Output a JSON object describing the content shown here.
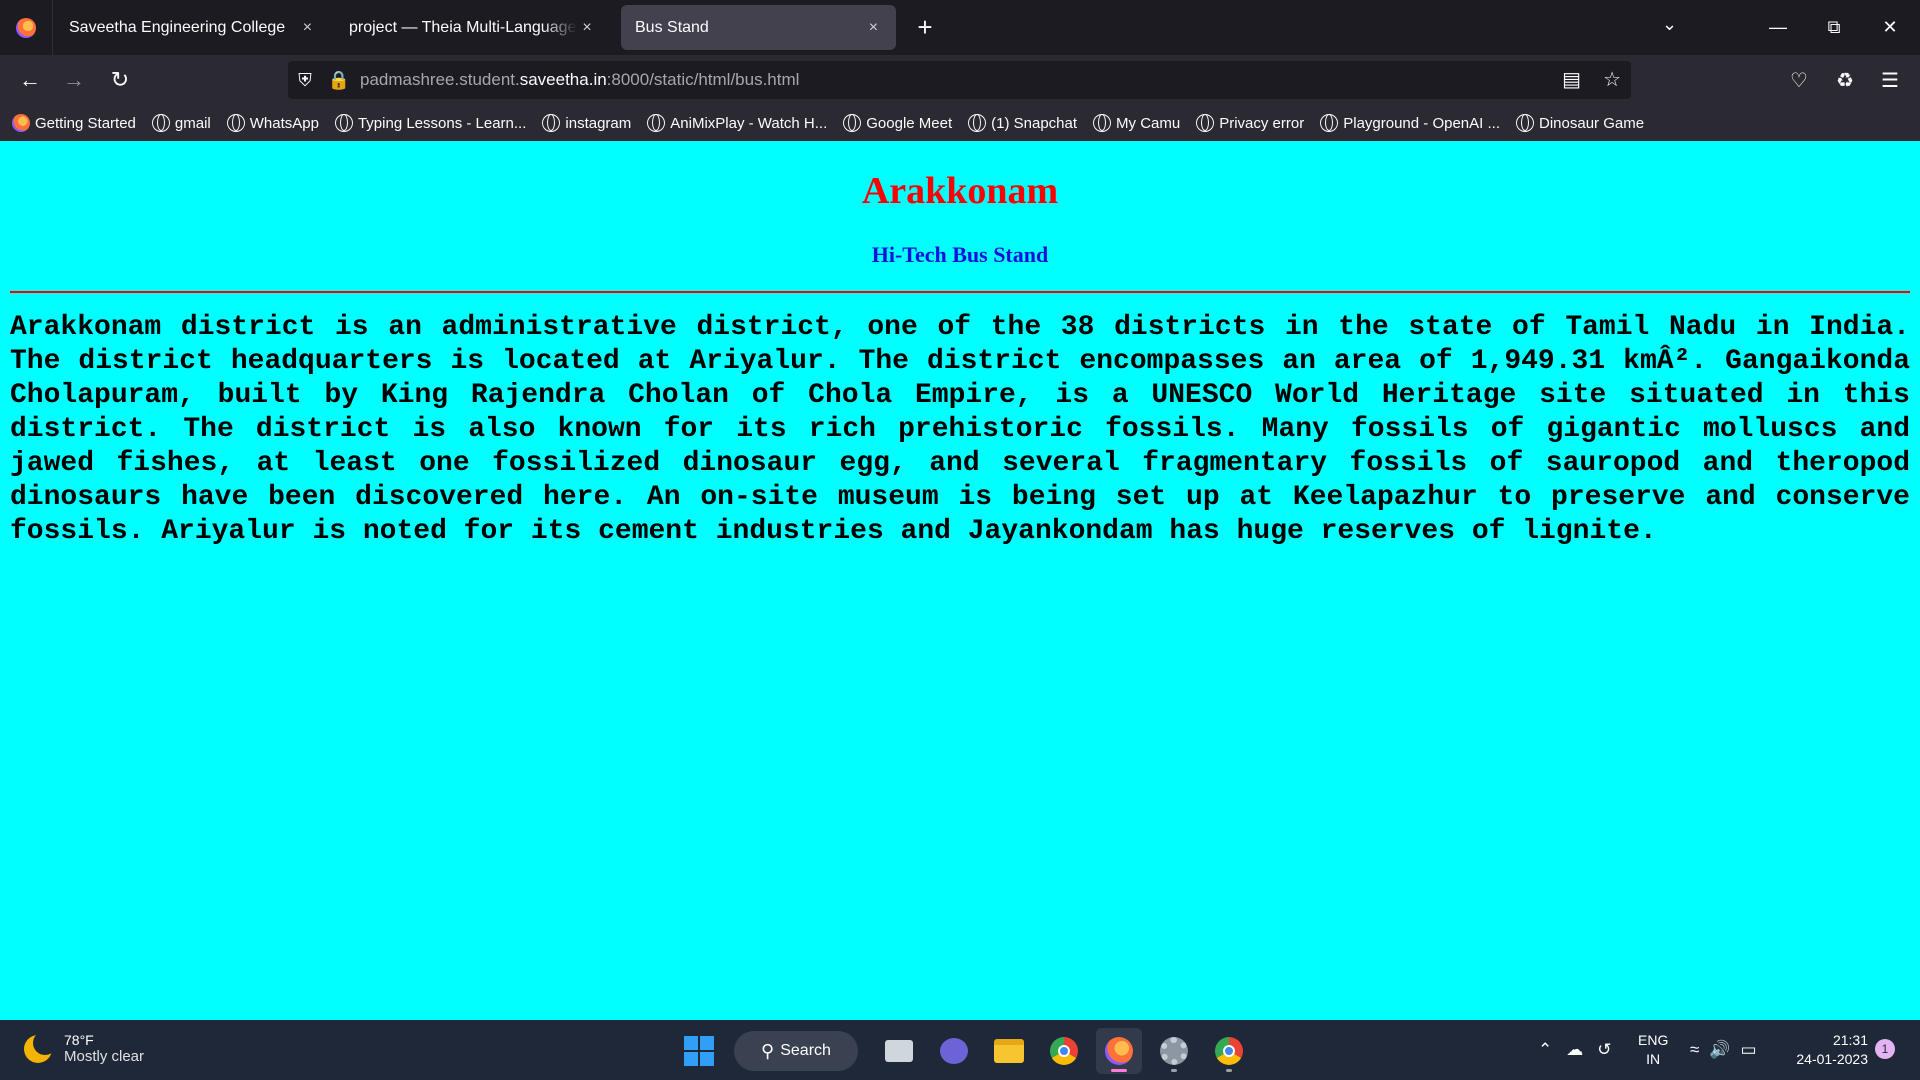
{
  "browser": {
    "tabs": [
      {
        "title": "Saveetha Engineering College",
        "active": false
      },
      {
        "title": "project — Theia Multi-Language Ex",
        "active": false
      },
      {
        "title": "Bus Stand",
        "active": true
      }
    ],
    "close_glyph": "×",
    "new_tab_glyph": "+",
    "url": {
      "prefix": "padmashree.student.",
      "domain": "saveetha.in",
      "suffix": ":8000/static/html/bus.html"
    },
    "bookmarks": [
      {
        "label": "Getting Started",
        "icon": "firefox-icon"
      },
      {
        "label": "gmail",
        "icon": "globe-icon"
      },
      {
        "label": "WhatsApp",
        "icon": "globe-icon"
      },
      {
        "label": "Typing Lessons - Learn...",
        "icon": "globe-icon"
      },
      {
        "label": "instagram",
        "icon": "globe-icon"
      },
      {
        "label": "AniMixPlay - Watch H...",
        "icon": "globe-icon"
      },
      {
        "label": "Google Meet",
        "icon": "globe-icon"
      },
      {
        "label": "(1) Snapchat",
        "icon": "globe-icon"
      },
      {
        "label": "My Camu",
        "icon": "globe-icon"
      },
      {
        "label": "Privacy error",
        "icon": "globe-icon"
      },
      {
        "label": "Playground - OpenAI ...",
        "icon": "globe-icon"
      },
      {
        "label": "Dinosaur Game",
        "icon": "globe-icon"
      }
    ]
  },
  "page": {
    "title": "Arakkonam",
    "subtitle": "Hi-Tech Bus Stand",
    "paragraph": "Arakkonam district is an administrative district, one of the 38 districts in the state of Tamil Nadu in India. The district headquarters is located at Ariyalur. The district encompasses an area of 1,949.31 kmÂ². Gangaikonda Cholapuram, built by King Rajendra Cholan of Chola Empire, is a UNESCO World Heritage site situated in this district. The district is also known for its rich prehistoric fossils. Many fossils of gigantic molluscs and jawed fishes, at least one fossilized dinosaur egg, and several fragmentary fossils of sauropod and theropod dinosaurs have been discovered here. An on-site museum is being set up at Keelapazhur to preserve and conserve fossils. Ariyalur is noted for its cement industries and Jayankondam has huge reserves of lignite.",
    "colors": {
      "background": "#00ffff",
      "title": "#ff0000",
      "subtitle": "#1111dd",
      "rule": "#ff0000"
    }
  },
  "taskbar": {
    "weather": {
      "temp": "78°F",
      "desc": "Mostly clear"
    },
    "search_label": "Search",
    "lang": {
      "line1": "ENG",
      "line2": "IN"
    },
    "clock": {
      "time": "21:31",
      "date": "24-01-2023"
    },
    "notification_count": "1"
  }
}
